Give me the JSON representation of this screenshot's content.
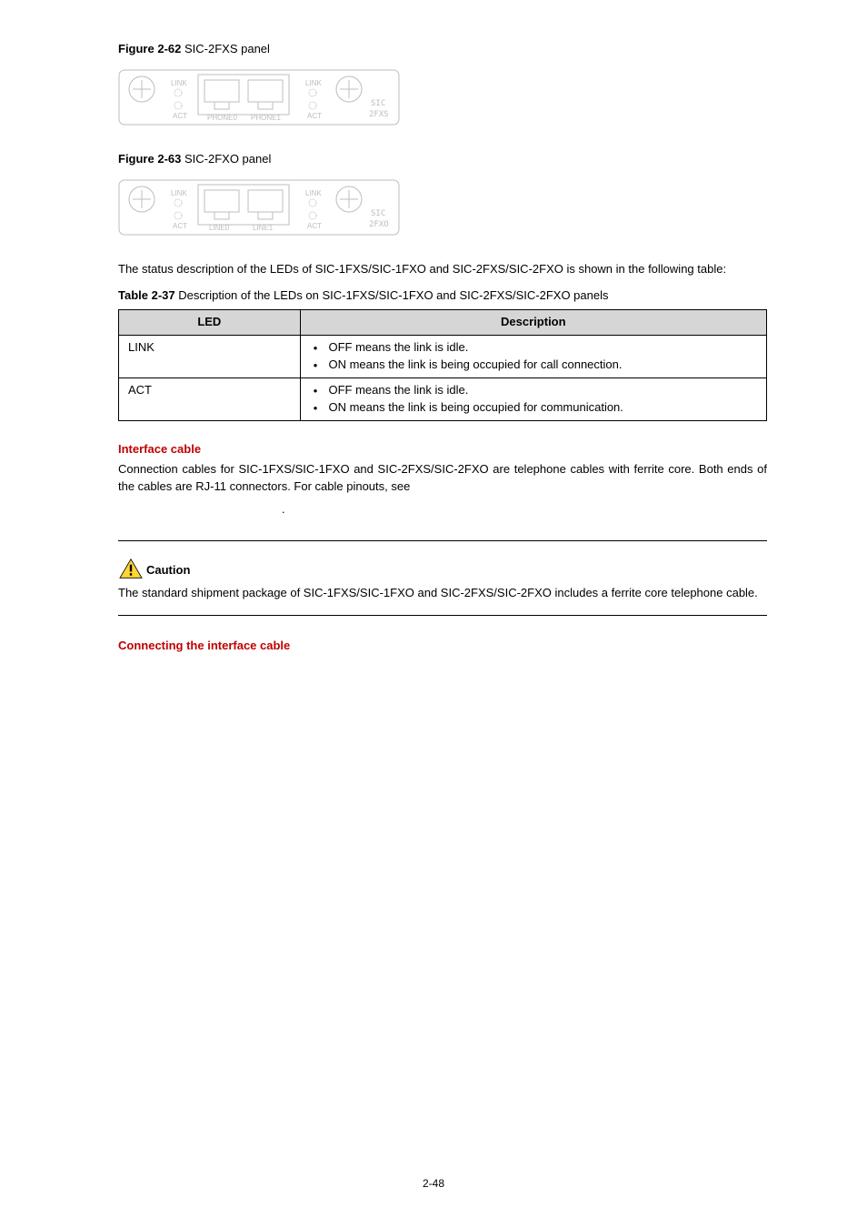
{
  "fig1": {
    "label": "Figure 2-62",
    "caption": "SIC-2FXS panel"
  },
  "fig2": {
    "label": "Figure 2-63",
    "caption": "SIC-2FXO panel"
  },
  "panel62": {
    "led1": "LINK",
    "led2": "ACT",
    "port0": "PHONE0",
    "port1": "PHONE1",
    "brand_top": "SIC",
    "brand_bot": "2FXS"
  },
  "panel63": {
    "led1": "LINK",
    "led2": "ACT",
    "port0": "LINE0",
    "port1": "LINE1",
    "brand_top": "SIC",
    "brand_bot": "2FXO"
  },
  "status_text": "The status description of the LEDs of SIC-1FXS/SIC-1FXO and SIC-2FXS/SIC-2FXO is shown in the following table:",
  "table_caption_label": "Table 2-37",
  "table_caption_text": "Description of the LEDs on SIC-1FXS/SIC-1FXO and SIC-2FXS/SIC-2FXO panels",
  "table": {
    "h1": "LED",
    "h2": "Description",
    "r1c1": "LINK",
    "r1b1": "OFF means the link is idle.",
    "r1b2": "ON means the link is being occupied for call connection.",
    "r2c1": "ACT",
    "r2b1": "OFF means the link is idle.",
    "r2b2": "ON means the link is being occupied for communication."
  },
  "iface_heading": "Interface cable",
  "iface_text": "Connection cables for SIC-1FXS/SIC-1FXO and SIC-2FXS/SIC-2FXO are telephone cables with ferrite core. Both ends of the cables are RJ-11 connectors. For cable pinouts, see",
  "dot": ".",
  "caution_label": "Caution",
  "caution_text": "The standard shipment package of SIC-1FXS/SIC-1FXO and SIC-2FXS/SIC-2FXO includes a ferrite core telephone cable.",
  "connect_heading": "Connecting the interface cable",
  "page_num": "2-48",
  "chart_data": [
    {
      "type": "table",
      "title": "LED status description",
      "columns": [
        "LED",
        "Description"
      ],
      "rows": [
        [
          "LINK",
          "OFF means the link is idle. / ON means the link is being occupied for call connection."
        ],
        [
          "ACT",
          "OFF means the link is idle. / ON means the link is being occupied for communication."
        ]
      ]
    }
  ]
}
